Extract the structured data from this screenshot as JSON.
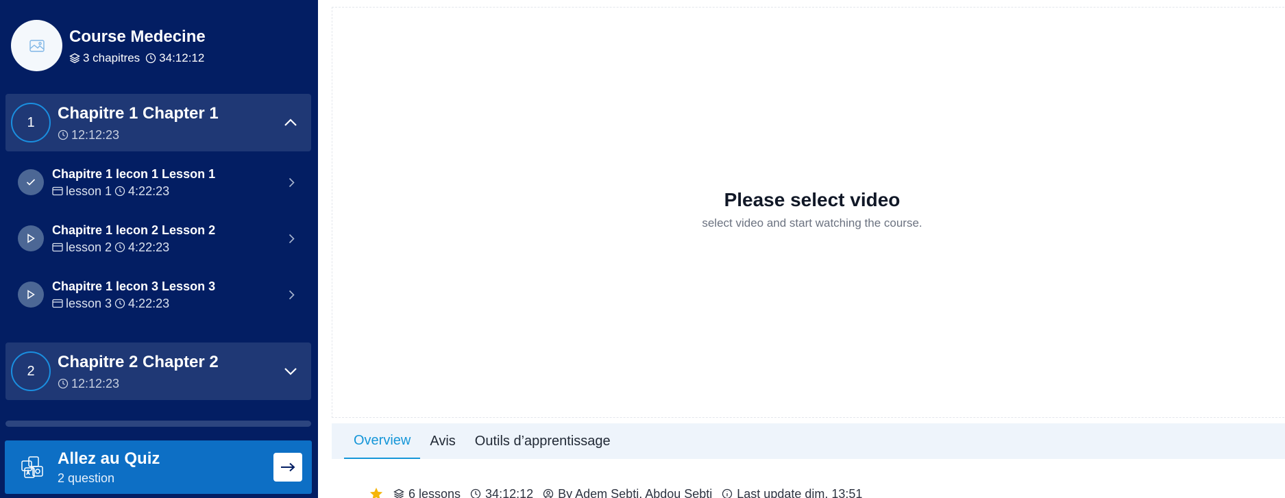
{
  "course": {
    "title": "Course Medecine",
    "chapters_count": "3 chapitres",
    "duration": "34:12:12"
  },
  "chapters": [
    {
      "number": "1",
      "title": "Chapitre 1 Chapter 1",
      "duration": "12:12:23",
      "expanded": true,
      "lessons": [
        {
          "title": "Chapitre 1 lecon 1 Lesson 1",
          "type_label": "lesson 1",
          "duration": "4:22:23",
          "status": "completed"
        },
        {
          "title": "Chapitre 1 lecon 2 Lesson 2",
          "type_label": "lesson 2",
          "duration": "4:22:23",
          "status": "play"
        },
        {
          "title": "Chapitre 1 lecon 3 Lesson 3",
          "type_label": "lesson 3",
          "duration": "4:22:23",
          "status": "play"
        }
      ]
    },
    {
      "number": "2",
      "title": "Chapitre 2 Chapter 2",
      "duration": "12:12:23",
      "expanded": false
    }
  ],
  "quiz": {
    "title": "Allez au Quiz",
    "subtitle": "2 question"
  },
  "player": {
    "empty_title": "Please select video",
    "empty_subtitle": "select video and start watching the course."
  },
  "tabs": [
    {
      "label": "Overview",
      "active": true
    },
    {
      "label": "Avis",
      "active": false
    },
    {
      "label": "Outils d’apprentissage",
      "active": false
    }
  ],
  "info": {
    "lessons": "6 lessons",
    "duration": "34:12:12",
    "author": "By  Adem Sebti, Abdou Sebti",
    "last_update": "Last update dim. 13:51"
  },
  "colors": {
    "sidebar_bg": "#031e63",
    "chapter_bg": "#1f3875",
    "accent": "#1596d8",
    "quiz_bg": "#0d6fc5",
    "star": "#f5b50a"
  },
  "icons": {
    "course_thumb": "image-icon",
    "chapters": "layers-icon",
    "duration": "clock-icon",
    "lesson_type": "card-icon",
    "completed": "check-icon",
    "play": "play-icon",
    "quiz": "quiz-icon",
    "author": "user-icon",
    "update": "info-icon",
    "rating": "star-icon"
  }
}
